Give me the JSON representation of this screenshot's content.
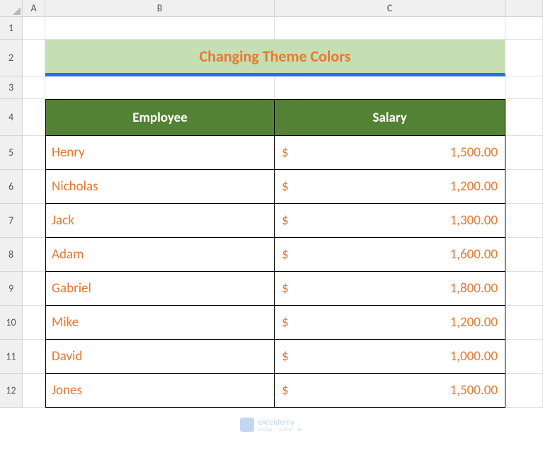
{
  "columns": [
    "A",
    "B",
    "C"
  ],
  "rows": [
    "1",
    "2",
    "3",
    "4",
    "5",
    "6",
    "7",
    "8",
    "9",
    "10",
    "11",
    "12"
  ],
  "title": "Changing Theme Colors",
  "table": {
    "headers": {
      "employee": "Employee",
      "salary": "Salary"
    },
    "currency": "$",
    "data": [
      {
        "name": "Henry",
        "salary": "1,500.00"
      },
      {
        "name": "Nicholas",
        "salary": "1,200.00"
      },
      {
        "name": "Jack",
        "salary": "1,300.00"
      },
      {
        "name": "Adam",
        "salary": "1,600.00"
      },
      {
        "name": "Gabriel",
        "salary": "1,800.00"
      },
      {
        "name": "Mike",
        "salary": "1,200.00"
      },
      {
        "name": "David",
        "salary": "1,000.00"
      },
      {
        "name": "Jones",
        "salary": "1,500.00"
      }
    ]
  },
  "watermark": {
    "brand": "exceldemy",
    "tagline": "EXCEL · DATA · BI"
  }
}
